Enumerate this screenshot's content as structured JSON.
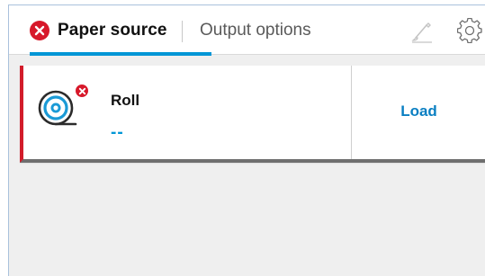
{
  "tabs": {
    "paper_source": {
      "label": "Paper source",
      "status_icon": "error-x-icon",
      "active": true
    },
    "output_options": {
      "label": "Output options",
      "active": false
    }
  },
  "toolbar": {
    "brush_icon": "brush-icon",
    "settings_icon": "gear-icon"
  },
  "roll_card": {
    "name": "Roll",
    "value": "--",
    "icon": "paper-roll-icon",
    "status_icon": "error-x-icon",
    "load_label": "Load"
  },
  "colors": {
    "accent": "#0096d6",
    "error": "#d7182a",
    "load_text": "#0a7fc2"
  }
}
